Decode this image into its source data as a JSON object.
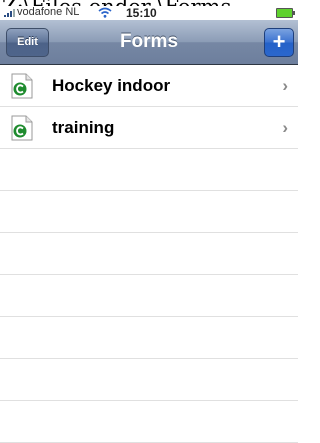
{
  "overlay_title": "Z:\\Files onder \\Forms",
  "status_bar": {
    "carrier": "vodafone NL",
    "time": "15:10"
  },
  "nav": {
    "title": "Forms",
    "edit_label": "Edit",
    "add_label": "+"
  },
  "forms": [
    {
      "label": "Hockey indoor",
      "icon": "form-document-icon"
    },
    {
      "label": "training",
      "icon": "form-document-icon"
    }
  ],
  "colors": {
    "nav_bar": "#8b9cb6",
    "add_button": "#2b67cd",
    "icon_green": "#1e8b2e"
  }
}
